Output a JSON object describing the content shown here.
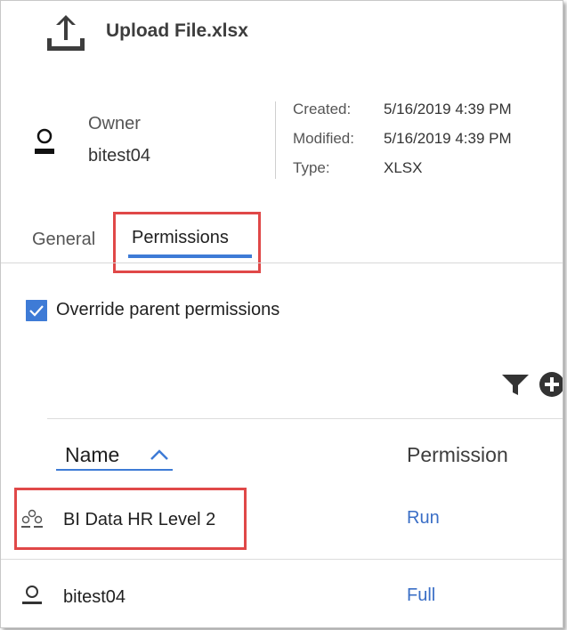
{
  "header": {
    "title": "Upload File.xlsx",
    "icon": "upload-icon"
  },
  "owner": {
    "label": "Owner",
    "value": "bitest04",
    "icon": "user-icon"
  },
  "metadata": [
    {
      "label": "Created:",
      "value": "5/16/2019 4:39 PM"
    },
    {
      "label": "Modified:",
      "value": "5/16/2019 4:39 PM"
    },
    {
      "label": "Type:",
      "value": "XLSX"
    }
  ],
  "tabs": [
    {
      "label": "General",
      "selected": false
    },
    {
      "label": "Permissions",
      "selected": true
    }
  ],
  "override": {
    "label": "Override parent permissions",
    "checked": true
  },
  "toolbar": {
    "icons": [
      "filter-icon",
      "add-icon"
    ]
  },
  "table": {
    "columns": {
      "name": "Name",
      "permission": "Permission"
    },
    "sort": "ascending",
    "rows": [
      {
        "name": "BI Data HR Level 2",
        "permission": "Run",
        "icon": "group-icon"
      },
      {
        "name": "bitest04",
        "permission": "Full",
        "icon": "user-icon"
      }
    ]
  },
  "colors": {
    "accent": "#3e7bd6",
    "highlight": "#e04848",
    "link": "#3a6ec6"
  }
}
